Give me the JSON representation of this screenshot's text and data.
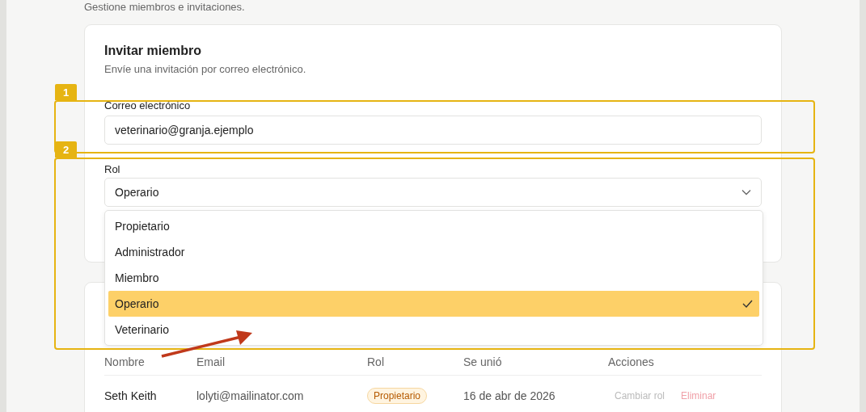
{
  "page": {
    "subtitle": "Gestione miembros e invitaciones."
  },
  "invite_card": {
    "title": "Invitar miembro",
    "description": "Envíe una invitación por correo electrónico.",
    "email_field": {
      "label": "Correo electrónico",
      "value": "veterinario@granja.ejemplo"
    },
    "role_field": {
      "label": "Rol",
      "value": "Operario",
      "expanded": true,
      "options": [
        {
          "label": "Propietario",
          "selected": false
        },
        {
          "label": "Administrador",
          "selected": false
        },
        {
          "label": "Miembro",
          "selected": false
        },
        {
          "label": "Operario",
          "selected": true
        },
        {
          "label": "Veterinario",
          "selected": false
        }
      ]
    }
  },
  "members_table": {
    "columns": [
      "Nombre",
      "Email",
      "Rol",
      "Se unió",
      "Acciones"
    ],
    "rows": [
      {
        "name": "Seth Keith",
        "email": "lolyti@mailinator.com",
        "role": "Propietario",
        "joined": "16 de abr de 2026",
        "actions": [
          "Cambiar rol",
          "Eliminar"
        ]
      }
    ]
  },
  "annotations": [
    {
      "number": "1"
    },
    {
      "number": "2"
    }
  ]
}
